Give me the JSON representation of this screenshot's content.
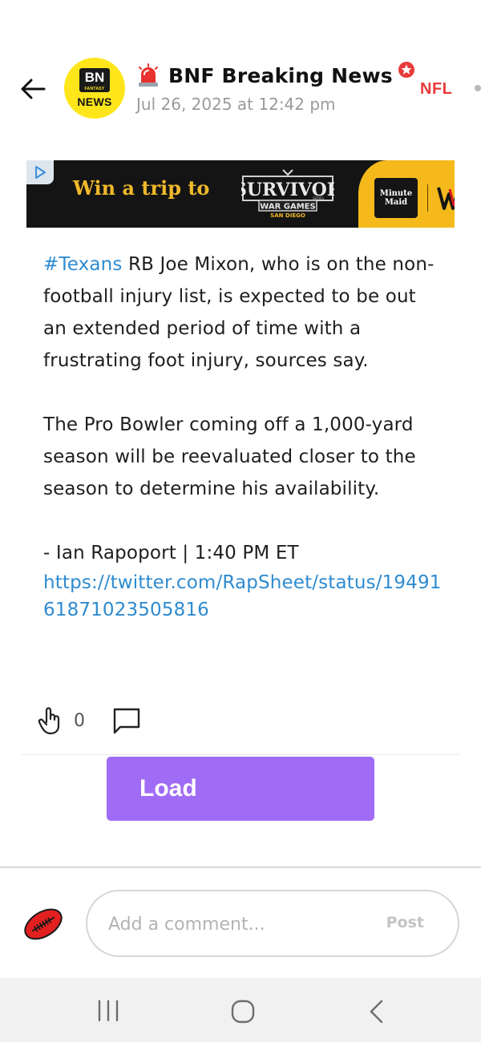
{
  "header": {
    "author": "BNF Breaking News",
    "timestamp": "Jul 26, 2025 at 12:42 pm",
    "league_tag": "NFL",
    "avatar": {
      "top_text": "BN",
      "small_text": "FANTASY",
      "bottom_text": "NEWS"
    },
    "icons": [
      "back-arrow-icon",
      "siren-icon",
      "badge-icon",
      "more-dot-icon"
    ]
  },
  "ad": {
    "headline": "Win a trip to",
    "logo_title": "SURVIVOR",
    "logo_sub1": "SERIES",
    "logo_sub2": "WAR GAMES",
    "logo_sub3": "SAN DIEGO",
    "sponsor_line1": "Minute",
    "sponsor_line2": "Maid",
    "brand_colors": {
      "gold": "#f0b92a",
      "yellow": "#f5b91c",
      "dark": "#141414"
    }
  },
  "post": {
    "hashtag": "#Texans",
    "paragraph1_rest": " RB Joe Mixon, who is on the non-football injury list, is expected to be out an extended period of time with a frustrating foot injury, sources say.",
    "paragraph2": "The Pro Bowler coming off a 1,000-yard season will be reevaluated closer to the season to determine his availability.",
    "attribution": "- Ian Rapoport | 1:40 PM ET",
    "link": "https://twitter.com/RapSheet/status/1949161871023505816"
  },
  "actions": {
    "clap_count": "0",
    "load_label": "Load"
  },
  "comment_bar": {
    "placeholder": "Add a comment...",
    "post_label": "Post"
  },
  "colors": {
    "link": "#2e8bd0",
    "load_button": "#a06cf5",
    "nfl_tag": "#e83a3a",
    "avatar_yellow": "#ffe61a"
  }
}
